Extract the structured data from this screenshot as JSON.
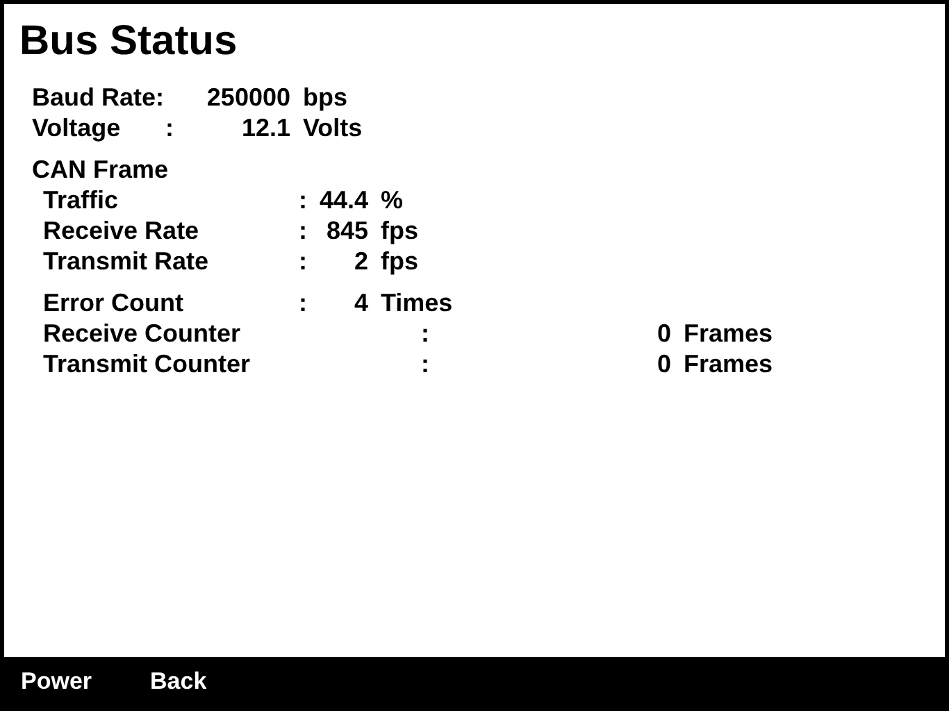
{
  "title": "Bus Status",
  "groups": [
    {
      "rows": [
        {
          "kind": "main",
          "label": "Baud Rate:",
          "value": "250000",
          "unit": "bps"
        },
        {
          "kind": "main",
          "label": "Voltage",
          "sep": ":",
          "value": "12.1",
          "unit": "Volts"
        }
      ]
    },
    {
      "heading": "CAN Frame",
      "rows": [
        {
          "kind": "frame",
          "label": "Traffic",
          "sep": ":",
          "value": "44.4",
          "unit": "%"
        },
        {
          "kind": "frame",
          "label": "Receive Rate",
          "sep": ":",
          "value": "845",
          "unit": "fps"
        },
        {
          "kind": "frame",
          "label": "Transmit Rate",
          "sep": ":",
          "value": "2",
          "unit": "fps"
        }
      ]
    },
    {
      "rows": [
        {
          "kind": "frame",
          "label": "Error Count",
          "sep": ":",
          "value": "4",
          "unit": "Times"
        },
        {
          "kind": "counter",
          "label": "Receive Counter",
          "sep": ":",
          "value": "0",
          "unit": "Frames"
        },
        {
          "kind": "counter",
          "label": "Transmit Counter",
          "sep": ":",
          "value": "0",
          "unit": "Frames"
        }
      ]
    }
  ],
  "softkeys": [
    "Power",
    "Back"
  ]
}
